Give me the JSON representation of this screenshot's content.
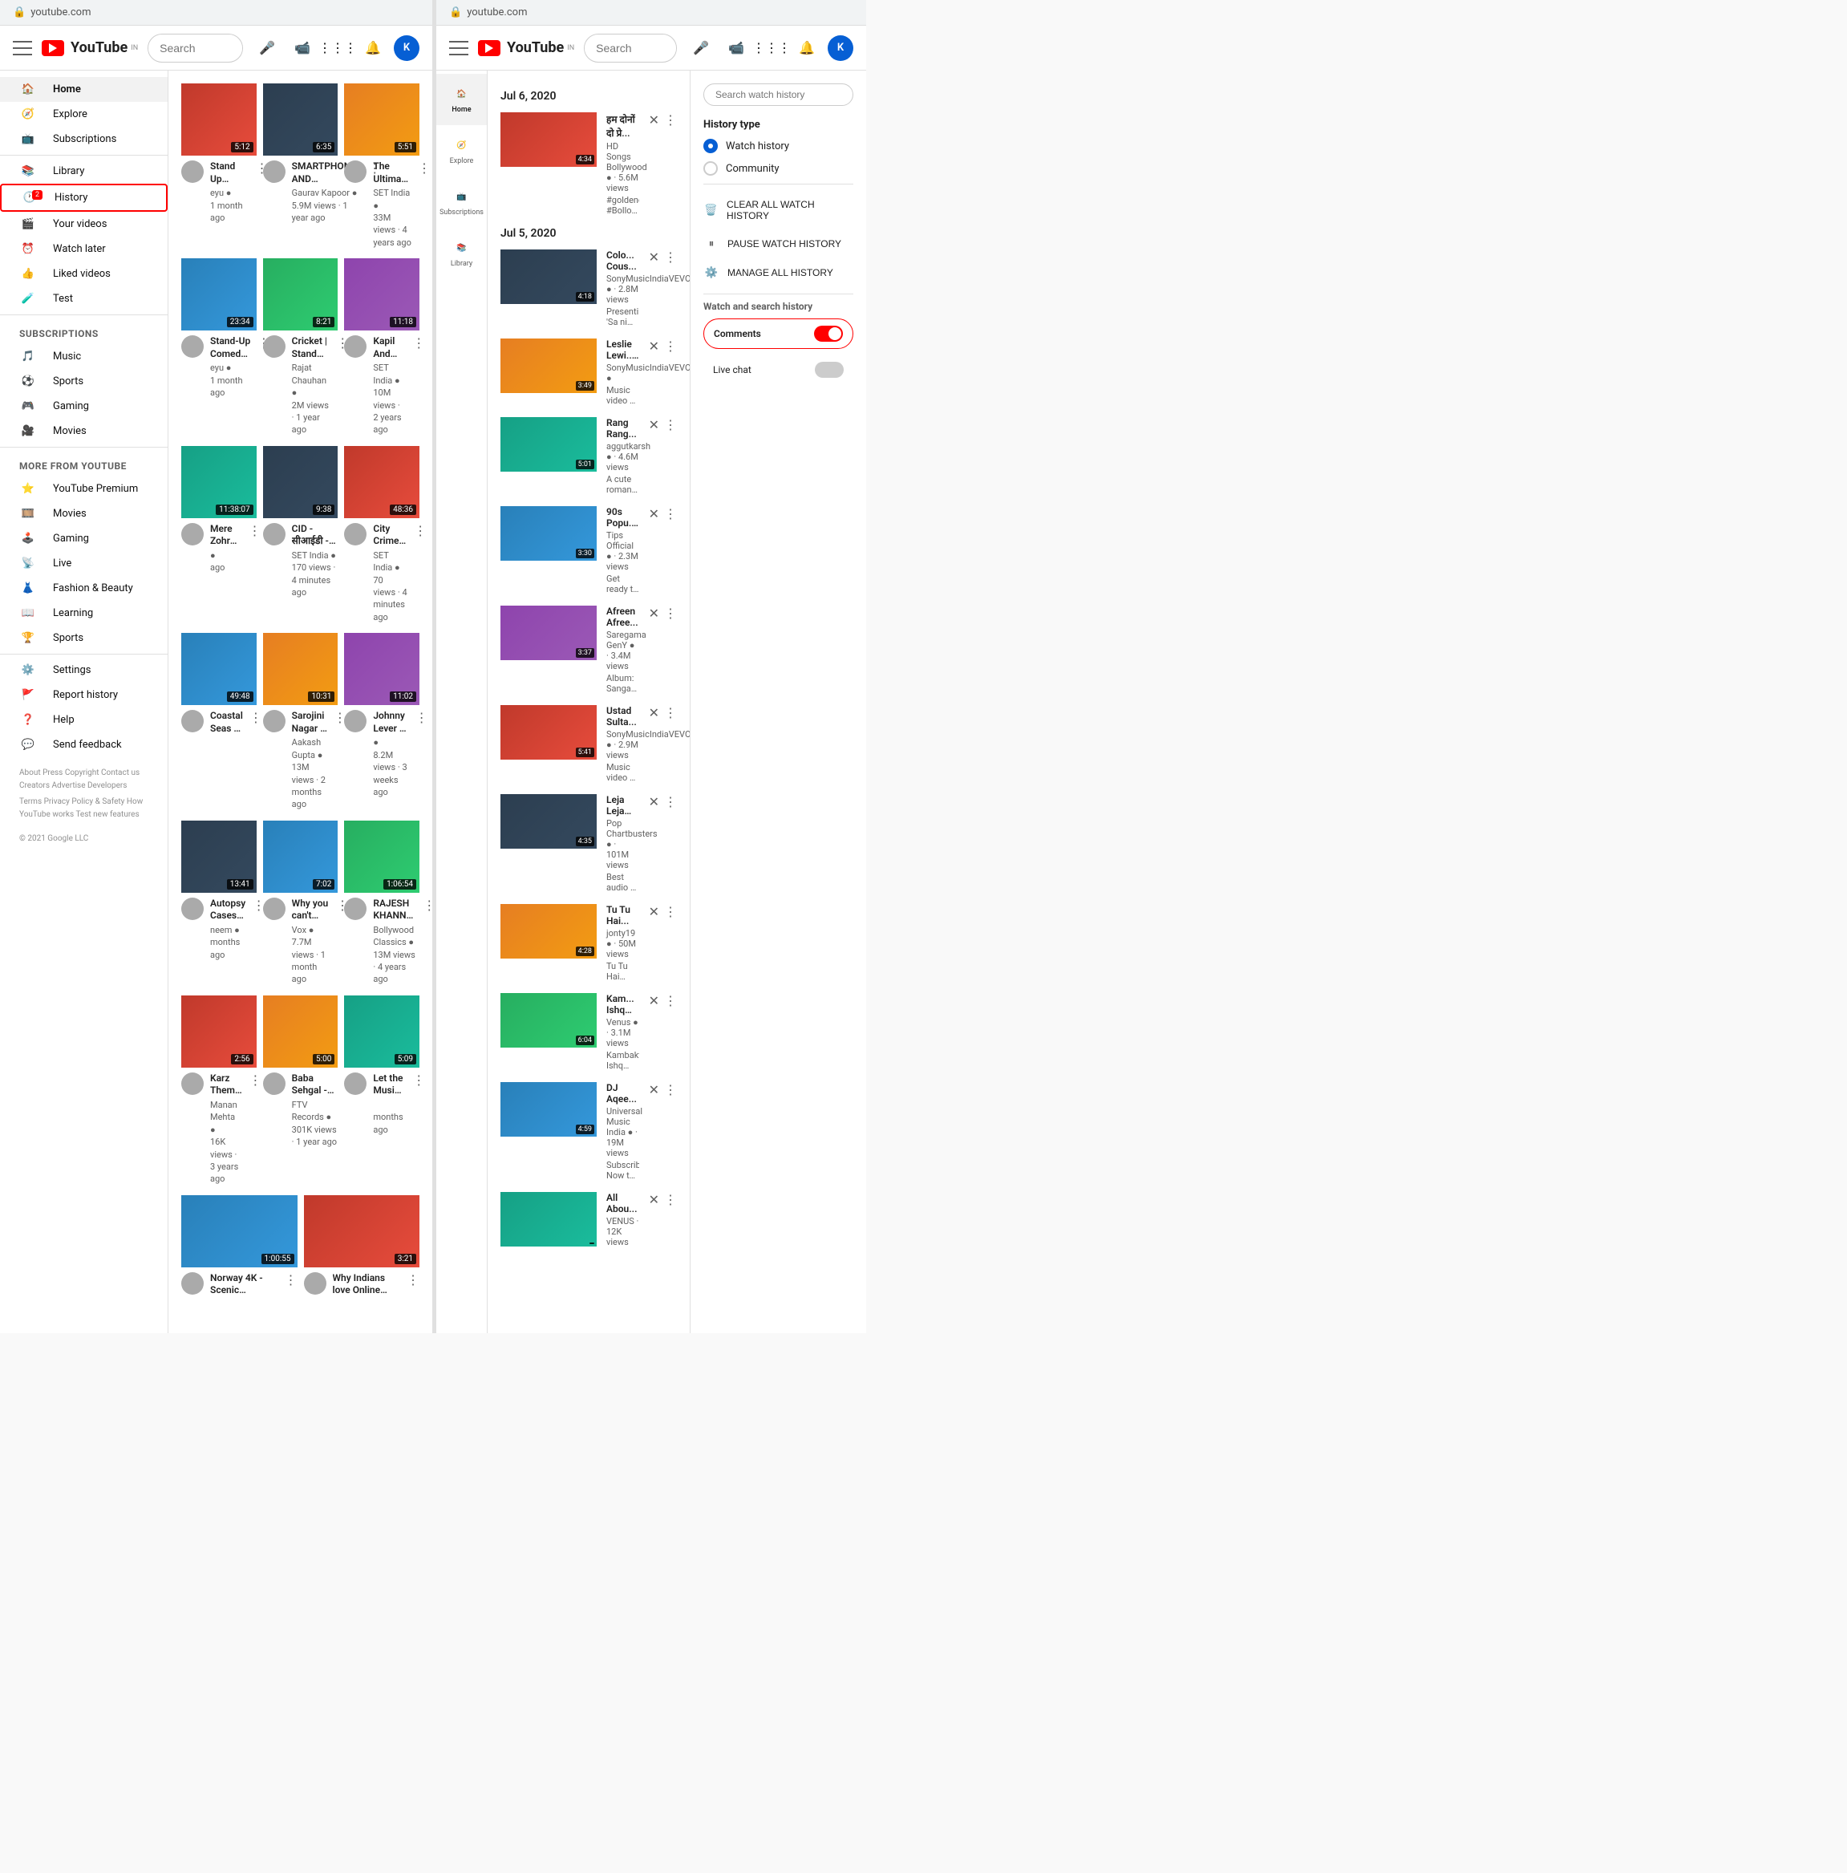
{
  "browser": {
    "url": "youtube.com",
    "url_right": "youtube.com"
  },
  "header": {
    "search_placeholder": "Search",
    "logo_text": "YouTube",
    "logo_sub": "IN"
  },
  "nav": {
    "items": [
      {
        "id": "home",
        "label": "Home",
        "icon": "home"
      },
      {
        "id": "explore",
        "label": "Explore",
        "icon": "compass"
      },
      {
        "id": "subscriptions",
        "label": "Subscriptions",
        "icon": "subscriptions"
      },
      {
        "id": "library",
        "label": "Library",
        "icon": "library"
      },
      {
        "id": "history",
        "label": "History",
        "icon": "history",
        "badge": "2"
      },
      {
        "id": "your-videos",
        "label": "Your videos",
        "icon": "video"
      },
      {
        "id": "watch-later",
        "label": "Watch later",
        "icon": "clock"
      },
      {
        "id": "liked-videos",
        "label": "Liked videos",
        "icon": "thumb"
      },
      {
        "id": "test",
        "label": "Test",
        "icon": "test"
      }
    ],
    "subscriptions_label": "SUBSCRIPTIONS",
    "subscriptions": [
      {
        "label": "Music"
      },
      {
        "label": "Sports"
      },
      {
        "label": "Gaming"
      },
      {
        "label": "Movies"
      }
    ],
    "more_from_yt_label": "MORE FROM YOUTUBE",
    "more_from_yt": [
      {
        "label": "YouTube Premium"
      },
      {
        "label": "Movies"
      },
      {
        "label": "Gaming"
      },
      {
        "label": "Live"
      },
      {
        "label": "Fashion & Beauty"
      },
      {
        "label": "Learning"
      },
      {
        "label": "Sports"
      }
    ],
    "settings_label": "Settings",
    "report_history_label": "Report history",
    "help_label": "Help",
    "feedback_label": "Send feedback",
    "footer": "About  Press  Copyright\nContact us  Creators\nAdvertise  Developers",
    "footer2": "Terms  Privacy  Policy & Safety\nHow YouTube works\nTest new features",
    "copyright": "© 2021 Google LLC"
  },
  "videos": [
    {
      "title": "Stand Up Comedy by Ashish Vidyarthi",
      "channel": "eyu ●",
      "meta": "1 month ago",
      "duration": "5:12",
      "thumb_class": "thumb-red"
    },
    {
      "title": "SMARTPHONES AND PASSWORDS | Stand Up...",
      "channel": "Gaurav Kapoor ●",
      "meta": "5.9M views · 1 year ago",
      "duration": "6:35",
      "thumb_class": "thumb-dark"
    },
    {
      "title": "The Ultimate Thug Life Of Dr. Mashoor Gulati | The Kapil...",
      "channel": "SET India ●",
      "meta": "33M views · 4 years ago",
      "duration": "5:51",
      "thumb_class": "thumb-orange"
    },
    {
      "title": "Stand-Up Comedy by Abhishek Upmanyu",
      "channel": "eyu ●",
      "meta": "1 month ago",
      "duration": "23:34",
      "thumb_class": "thumb-blue"
    },
    {
      "title": "Cricket | Stand Up Comedy By Rajat Chauhan (17th Video)",
      "channel": "Rajat Chauhan ●",
      "meta": "2M views · 1 year ago",
      "duration": "8:21",
      "thumb_class": "thumb-green"
    },
    {
      "title": "Kapil And Sudesh As Best Jodi Singers - Jodi Kamaal Ki",
      "channel": "SET India ●",
      "meta": "10M views · 2 years ago",
      "duration": "11:18",
      "thumb_class": "thumb-purple"
    },
    {
      "title": "Mere Zohra Jabeen Wade Pyar...",
      "channel": "●",
      "meta": "ago",
      "duration": "11:38:07",
      "thumb_class": "thumb-teal"
    },
    {
      "title": "CID - सीआईडी - Ep 938 - CID-Commando Integration - Full...",
      "channel": "SET India ●",
      "meta": "170 views · 4 minutes ago",
      "duration": "9:38",
      "thumb_class": "thumb-dark"
    },
    {
      "title": "City Crime | Crime Patrol | शहरी | Full Episode",
      "channel": "SET India ●",
      "meta": "70 views · 4 minutes ago",
      "duration": "48:36",
      "thumb_class": "thumb-red"
    },
    {
      "title": "Coastal Seas | FULL …x",
      "channel": "",
      "meta": "",
      "duration": "49:48",
      "thumb_class": "thumb-blue"
    },
    {
      "title": "Sarojini Nagar | Excuse Me Brother | Stand-Up Comedy by...",
      "channel": "Aakash Gupta ●",
      "meta": "13M views · 2 months ago",
      "duration": "10:31",
      "thumb_class": "thumb-orange"
    },
    {
      "title": "Johnny Lever से हास हो रही है Sapna की Comedy Talks | The...",
      "channel": "●",
      "meta": "8.2M views · 3 weeks ago",
      "duration": "11:02",
      "thumb_class": "thumb-purple"
    },
    {
      "title": "Autopsy Cases | How COVID...",
      "channel": "neem ●",
      "meta": "months ago",
      "duration": "13:41",
      "thumb_class": "thumb-dark"
    },
    {
      "title": "Why you can't compare Covid-19 vaccines",
      "channel": "Vox ●",
      "meta": "7.7M views · 1 month ago",
      "duration": "7:02",
      "thumb_class": "thumb-blue"
    },
    {
      "title": "RAJESH KHANNA Hit Songs | Evergreen Hindi Songs | Best...",
      "channel": "Bollywood Classics ●",
      "meta": "13M views · 4 years ago",
      "duration": "1:06:54",
      "thumb_class": "thumb-green"
    },
    {
      "title": "Karz Theme Music - A humble tribute to the original player, S...",
      "channel": "Manan Mehta ●",
      "meta": "16K views · 3 years ago",
      "duration": "2:56",
      "thumb_class": "thumb-red"
    },
    {
      "title": "Baba Sehgal - Thanda Thanda Pani(1992)",
      "channel": "FTV Records ●",
      "meta": "301K views · 1 year ago",
      "duration": "5:00",
      "thumb_class": "thumb-orange"
    },
    {
      "title": "Let the Music Flow | Sachin-Janhvi | B Praak Ft Sidiqui & Suni...",
      "channel": "",
      "meta": "months ago",
      "duration": "5:09",
      "thumb_class": "thumb-teal"
    },
    {
      "title": "Norway 4K - Scenic Relaxation",
      "channel": "",
      "meta": "",
      "duration": "1:00:55",
      "thumb_class": "thumb-blue"
    },
    {
      "title": "Why Indians love Online Shopping | Part 1 | Stand-Up...",
      "channel": "",
      "meta": "",
      "duration": "3:21",
      "thumb_class": "thumb-red"
    }
  ],
  "right_panel": {
    "dates": [
      {
        "label": "Jul 6, 2020"
      },
      {
        "label": "Jul 5, 2020"
      }
    ],
    "history_items": [
      {
        "date_group": 0,
        "title": "हम दोनों दो प्रे...",
        "channel": "HD Songs Bollywood ●",
        "channel_verified": true,
        "views": "5.6M views",
        "tags": "#goldenoldsongs #Bolloldsongs गाने /",
        "duration": "4:34",
        "thumb_class": "thumb-red"
      },
      {
        "date_group": 1,
        "title": "Colo... Cous...",
        "channel": "SonyMusicIndiaVEVO ●",
        "views": "2.8M views",
        "desc": "Presenting 'Sa ni Dha Pa' music video sung by",
        "duration": "4:18",
        "thumb_class": "thumb-dark"
      },
      {
        "date_group": 1,
        "title": "Leslie Lewi... Kai Zhala",
        "channel": "SonyMusicIndiaVEVO ●",
        "views": "",
        "desc": "Music video by Leslie Lewis, Hariharan",
        "duration": "3:49",
        "thumb_class": "thumb-orange"
      },
      {
        "date_group": 1,
        "title": "Rang Rang...",
        "channel": "aggutkarsh ●",
        "views": "4.6M views",
        "desc": "A cute romantic song from the movie.",
        "duration": "5:01",
        "thumb_class": "thumb-teal"
      },
      {
        "date_group": 1,
        "title": "90s Popu... Telephone Dhoon Mein",
        "channel": "Tips Official ●",
        "views": "2.3M views",
        "desc": "Get ready to groove on the peppy song 'Telephone",
        "duration": "3:30",
        "thumb_class": "thumb-blue"
      },
      {
        "date_group": 1,
        "title": "Afreen Afree...",
        "channel": "Saregama GenY ●",
        "views": "3.4M views",
        "desc": "Album: Sangam Song Afreen Afreen Singer",
        "duration": "3:37",
        "thumb_class": "thumb-purple"
      },
      {
        "date_group": 1,
        "title": "Ustad Sulta...",
        "channel": "SonyMusicIndiaVEVO ●",
        "views": "2.9M views",
        "desc": "Music video by Ustad Sultan Khan, Chithra",
        "duration": "5:41",
        "thumb_class": "thumb-red"
      },
      {
        "date_group": 1,
        "title": "Leja Leja Leja Re",
        "channel": "Pop Chartbusters ●",
        "views": "101M views",
        "desc": "Best audio & Video mix by Ustad Sultan Khan &",
        "duration": "4:35",
        "thumb_class": "thumb-dark"
      },
      {
        "date_group": 1,
        "title": "Tu Tu Hai...",
        "channel": "jonty19 ●",
        "views": "50M views",
        "desc": "Tu Tu Hai Wahi Dil Ne Jise Apna Kaha Bollywood",
        "duration": "4:28",
        "thumb_class": "thumb-orange"
      },
      {
        "date_group": 1,
        "title": "Kam... Ishq -... Kambakth Ishq",
        "channel": "Venus ●",
        "views": "3.1M views",
        "desc": "Kambakth Ishq Song from the Bollywood Movie",
        "duration": "6:04",
        "thumb_class": "thumb-green"
      },
      {
        "date_group": 1,
        "title": "DJ Aqee...",
        "channel": "Universal Music India ●",
        "views": "19M views",
        "desc": "Subscribe Now to VYRLOriginals-",
        "duration": "4:59",
        "thumb_class": "thumb-blue"
      },
      {
        "date_group": 1,
        "title": "All Abou...",
        "channel": "VENUS",
        "views": "12K views",
        "desc": "",
        "duration": "",
        "thumb_class": "thumb-teal"
      }
    ],
    "search_watch_history_placeholder": "Search watch history",
    "history_type_label": "History type",
    "watch_history_label": "Watch history",
    "community_label": "Community",
    "clear_all_label": "CLEAR ALL WATCH HISTORY",
    "pause_label": "PAUSE WATCH HISTORY",
    "manage_label": "MANAGE ALL HISTORY",
    "watch_search_label": "Watch and search history",
    "comments_label": "Comments",
    "live_chat_label": "Live chat"
  }
}
